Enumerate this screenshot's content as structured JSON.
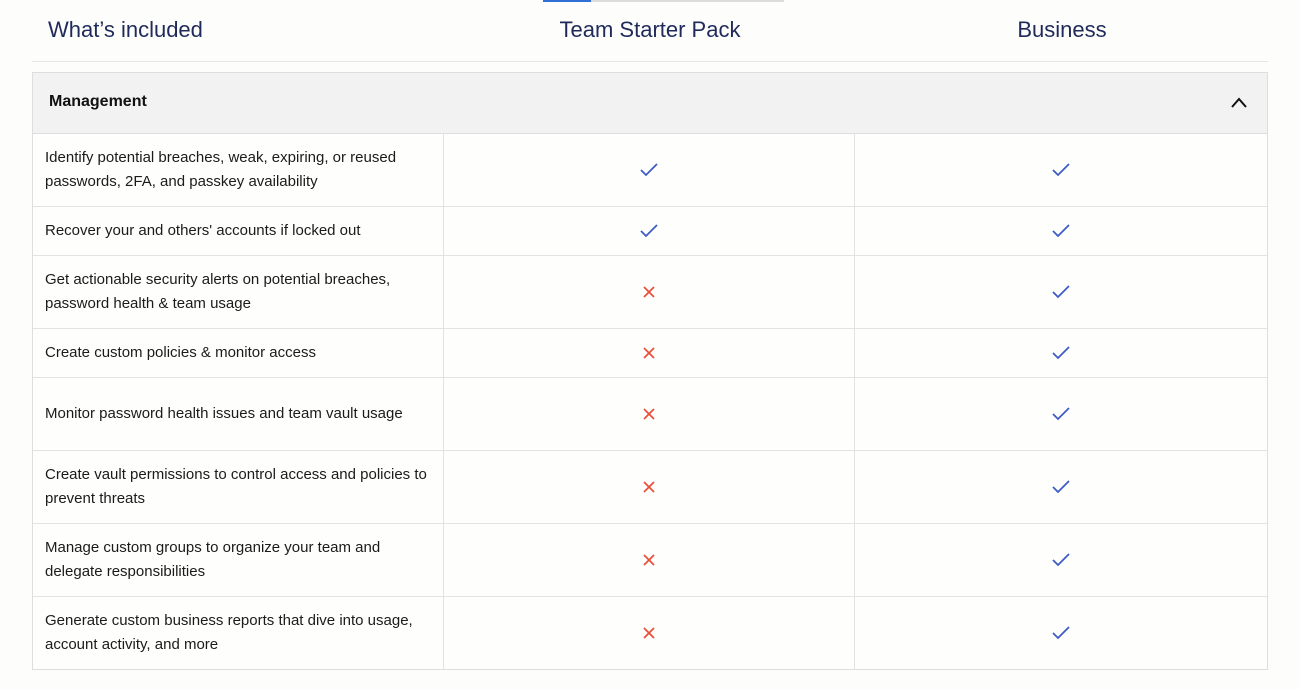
{
  "header": {
    "what_included": "What’s included",
    "plan_1": "Team Starter Pack",
    "plan_2": "Business"
  },
  "section": {
    "title": "Management",
    "expanded": true,
    "chevron_icon": "chevron-up-icon"
  },
  "colors": {
    "check": "#3d5cc8",
    "cross": "#e8503a",
    "title": "#1f2a5a",
    "tab_active": "#2f6fd6"
  },
  "rows": [
    {
      "feature": "Identify potential breaches, weak, expiring, or reused passwords, 2FA, and passkey availability",
      "team_starter": "check",
      "business": "check"
    },
    {
      "feature": "Recover your and others' accounts if locked out",
      "team_starter": "check",
      "business": "check"
    },
    {
      "feature": "Get actionable security alerts on potential breaches, password health & team usage",
      "team_starter": "cross",
      "business": "check"
    },
    {
      "feature": "Create custom policies & monitor access",
      "team_starter": "cross",
      "business": "check"
    },
    {
      "feature": "Monitor password health issues and team vault usage",
      "team_starter": "cross",
      "business": "check"
    },
    {
      "feature": "Create vault permissions to control access and policies to prevent threats",
      "team_starter": "cross",
      "business": "check"
    },
    {
      "feature": "Manage custom groups to organize your team and delegate responsibilities",
      "team_starter": "cross",
      "business": "check"
    },
    {
      "feature": "Generate custom business reports that dive into usage, account activity, and more",
      "team_starter": "cross",
      "business": "check"
    }
  ]
}
